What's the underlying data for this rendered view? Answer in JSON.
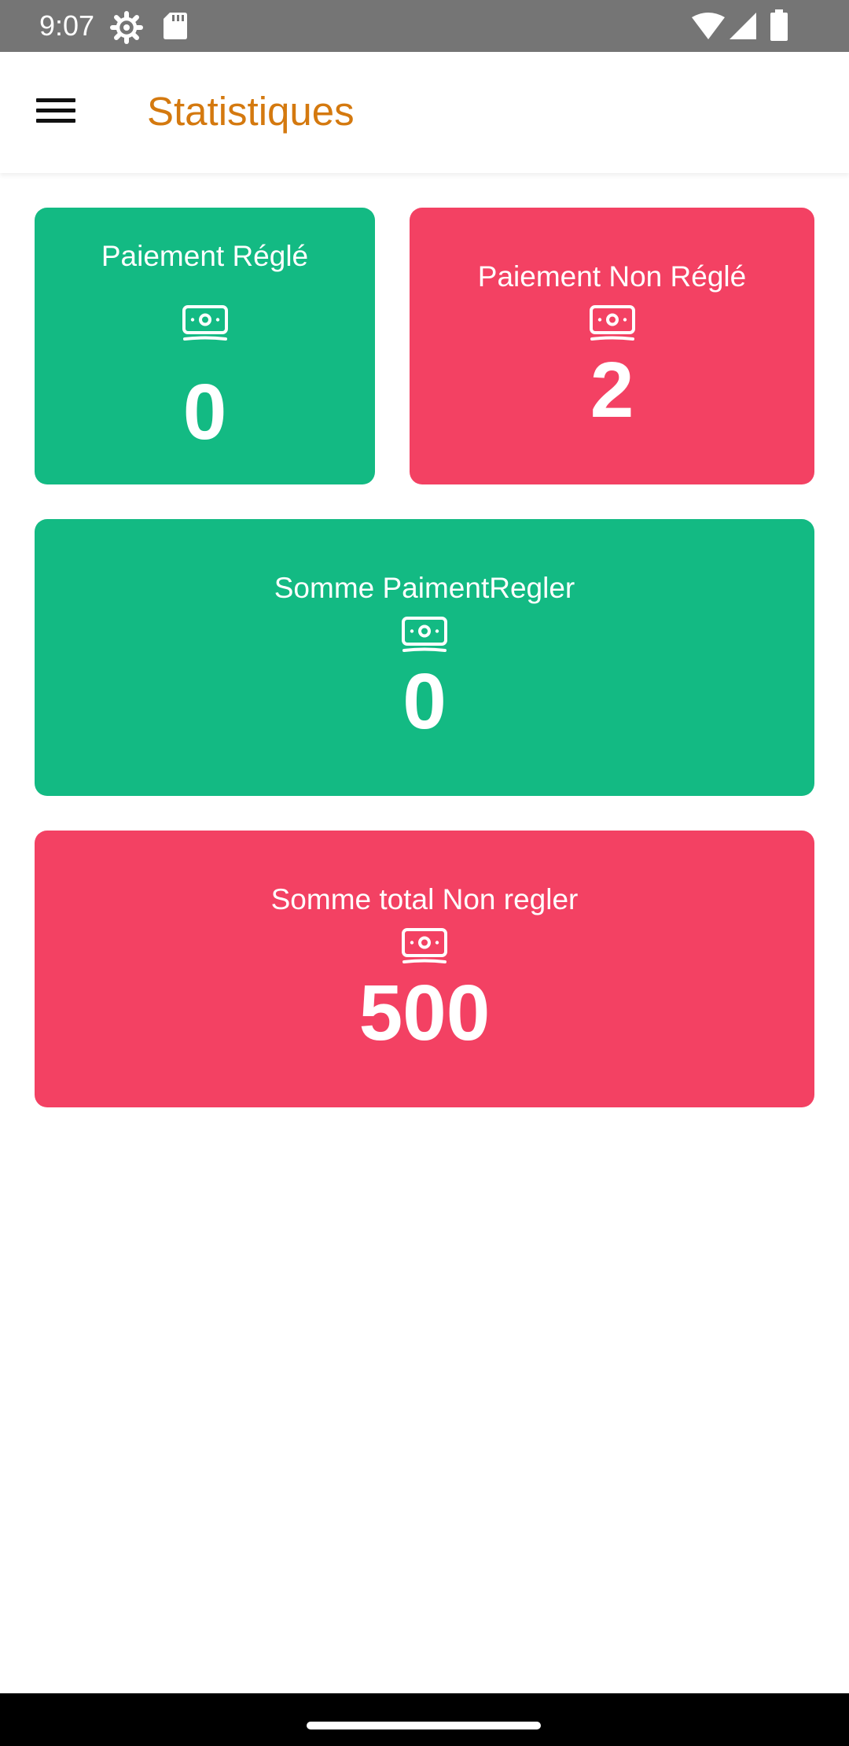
{
  "status_bar": {
    "time": "9:07",
    "icons": [
      "settings-gear-icon",
      "sd-card-icon",
      "wifi-icon",
      "cellular-signal-icon",
      "battery-icon"
    ]
  },
  "app_bar": {
    "menu_icon": "hamburger-menu-icon",
    "title": "Statistiques"
  },
  "cards": [
    {
      "label": "Paiement Réglé",
      "icon": "money-icon",
      "value": "0"
    },
    {
      "label": "Paiement Non Réglé",
      "icon": "money-icon",
      "value": "2"
    },
    {
      "label": "Somme PaimentRegler",
      "icon": "money-icon",
      "value": "0"
    },
    {
      "label": "Somme total Non regler",
      "icon": "money-icon",
      "value": "500"
    }
  ],
  "colors": {
    "title": "#D4790F",
    "paid_card": "#13BA83",
    "unpaid_card": "#F34163",
    "status_bar": "#757575"
  },
  "nav_bar": {
    "handle": "home-gesture-handle"
  }
}
